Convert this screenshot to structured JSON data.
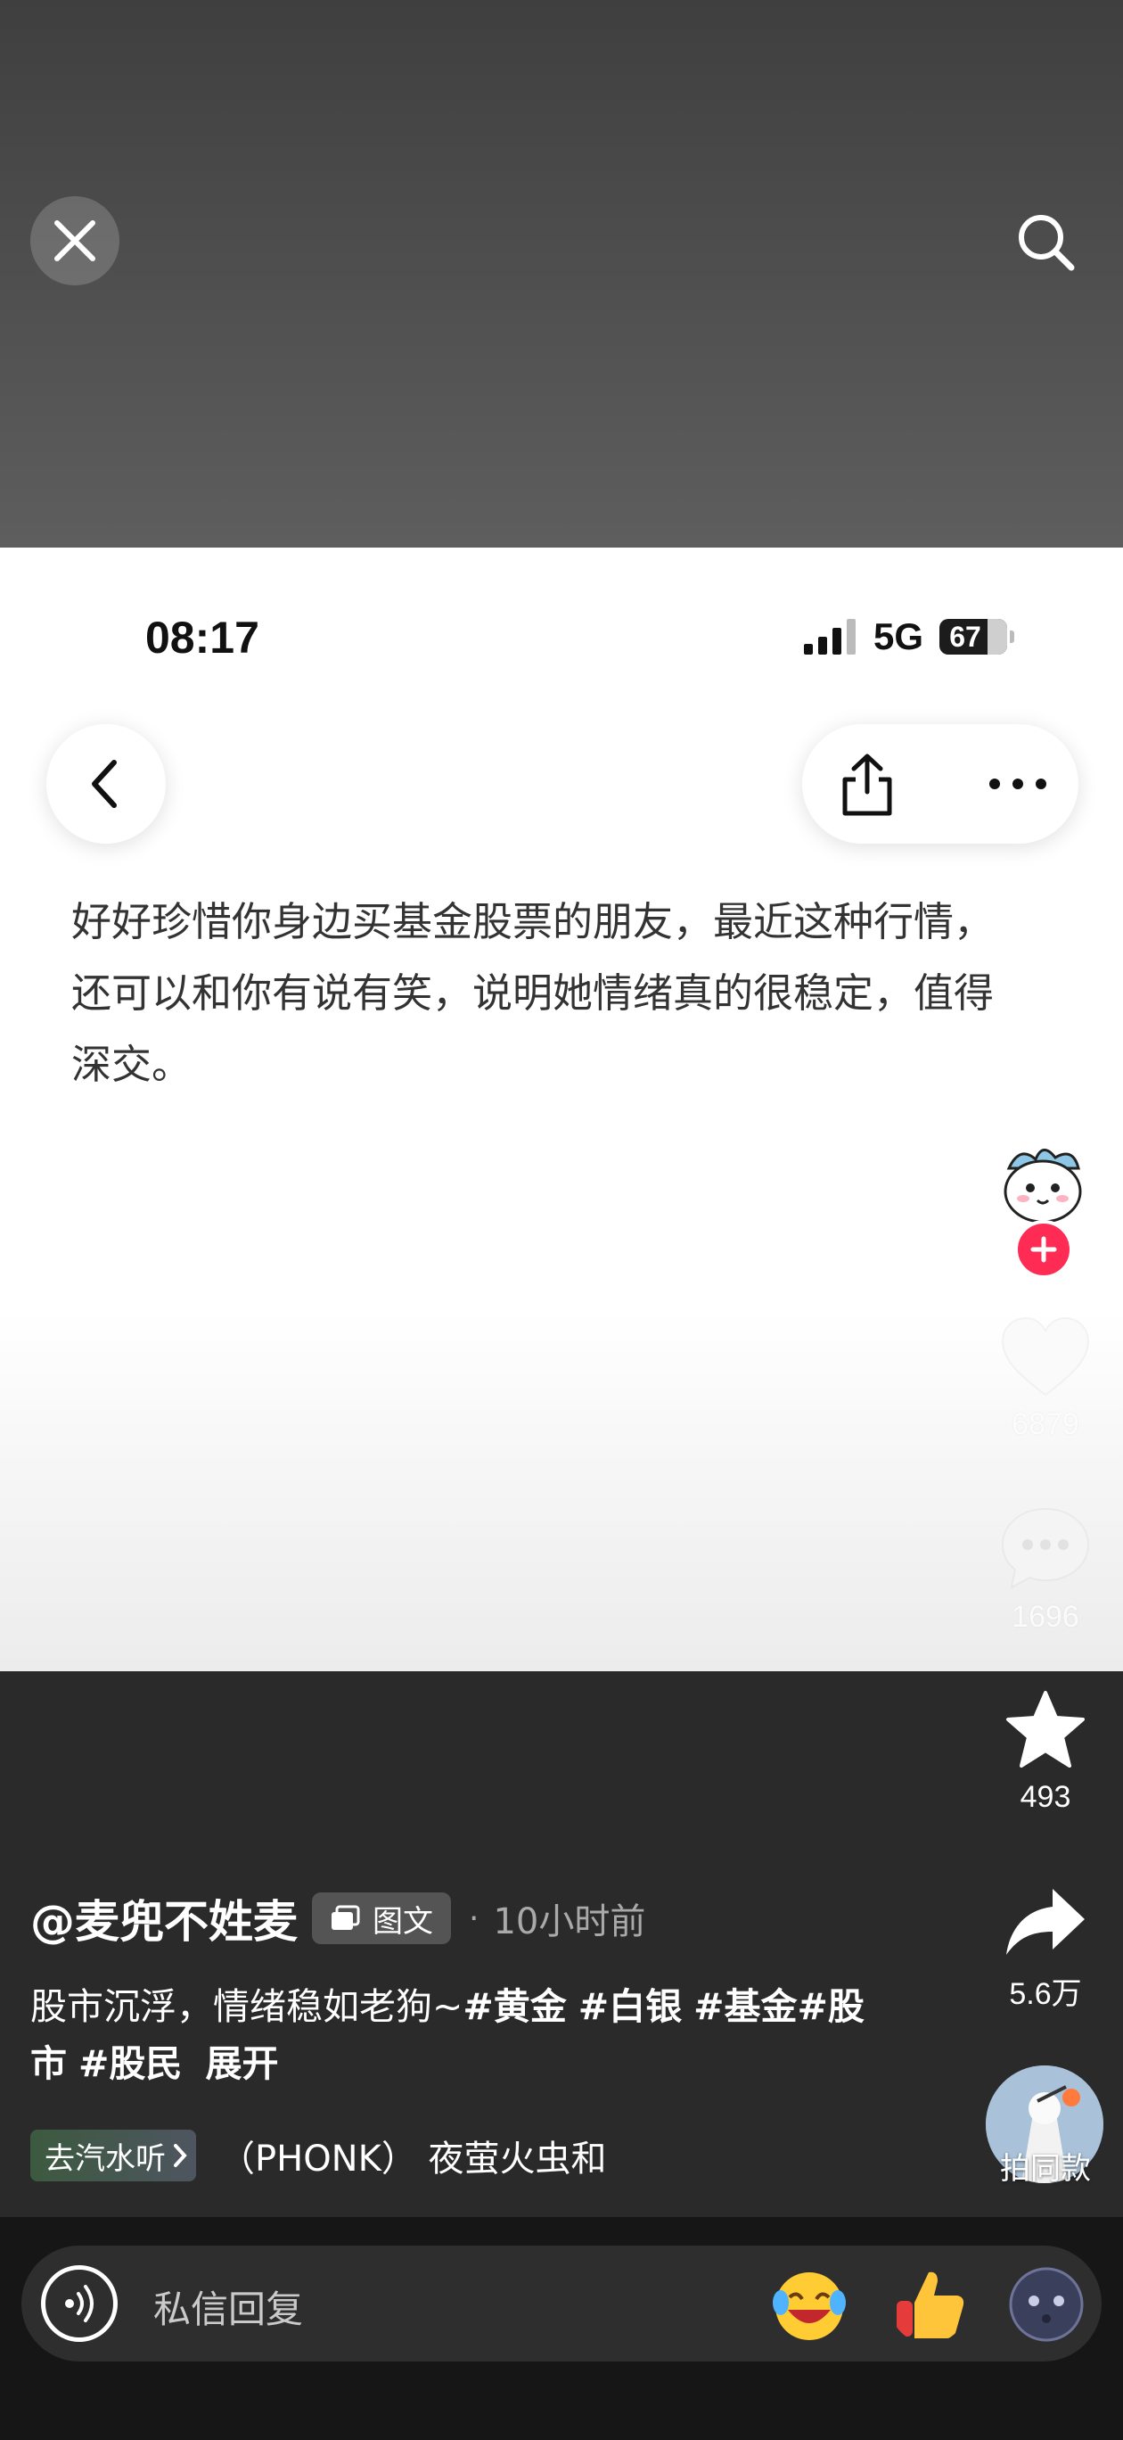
{
  "status_bar": {
    "time": "08:17",
    "network": "5G",
    "battery": "67"
  },
  "post": {
    "text": "好好珍惜你身边买基金股票的朋友，最近这种行情，还可以和你有说有笑，说明她情绪真的很稳定，值得深交。",
    "author": "@麦兜不姓麦",
    "type_label": "图文",
    "separator": "·",
    "time_ago": "10小时前",
    "caption_text": "股市沉浮，情绪稳如老狗~",
    "hashtags": [
      "#黄金",
      "#白银",
      "#基金#股市",
      "#股民"
    ],
    "expand_label": "展开"
  },
  "stats": {
    "likes": "6879",
    "comments": "1696",
    "favorites": "493",
    "shares": "5.6万"
  },
  "remix_label": "拍同款",
  "music": {
    "chip_label": "去汽水听",
    "track_text": "（PHONK）    夜萤火虫和"
  },
  "reply": {
    "placeholder": "私信回复"
  },
  "icons": {
    "close": "close-icon",
    "search": "search-icon",
    "back": "chevron-left-icon",
    "share": "share-icon",
    "more": "more-icon",
    "like": "heart-icon",
    "comment": "comment-icon",
    "favorite": "star-icon",
    "forward": "forward-icon",
    "voice": "voice-icon"
  },
  "colors": {
    "follow_plus": "#fe2c55",
    "top_band": "#4a4a4a",
    "bottom_bar": "#161616"
  }
}
